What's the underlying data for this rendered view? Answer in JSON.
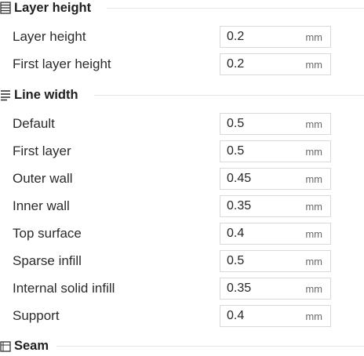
{
  "sections": {
    "layer_height": {
      "title": "Layer height",
      "icon": "layers-icon",
      "rows": [
        {
          "label": "Layer height",
          "value": "0.2",
          "unit": "mm"
        },
        {
          "label": "First layer height",
          "value": "0.2",
          "unit": "mm"
        }
      ]
    },
    "line_width": {
      "title": "Line width",
      "icon": "line-width-icon",
      "rows": [
        {
          "label": "Default",
          "value": "0.5",
          "unit": "mm"
        },
        {
          "label": "First layer",
          "value": "0.5",
          "unit": "mm"
        },
        {
          "label": "Outer wall",
          "value": "0.45",
          "unit": "mm"
        },
        {
          "label": "Inner wall",
          "value": "0.35",
          "unit": "mm"
        },
        {
          "label": "Top surface",
          "value": "0.4",
          "unit": "mm"
        },
        {
          "label": "Sparse infill",
          "value": "0.5",
          "unit": "mm"
        },
        {
          "label": "Internal solid infill",
          "value": "0.35",
          "unit": "mm"
        },
        {
          "label": "Support",
          "value": "0.4",
          "unit": "mm"
        }
      ]
    },
    "seam": {
      "title": "Seam",
      "icon": "seam-icon"
    }
  }
}
